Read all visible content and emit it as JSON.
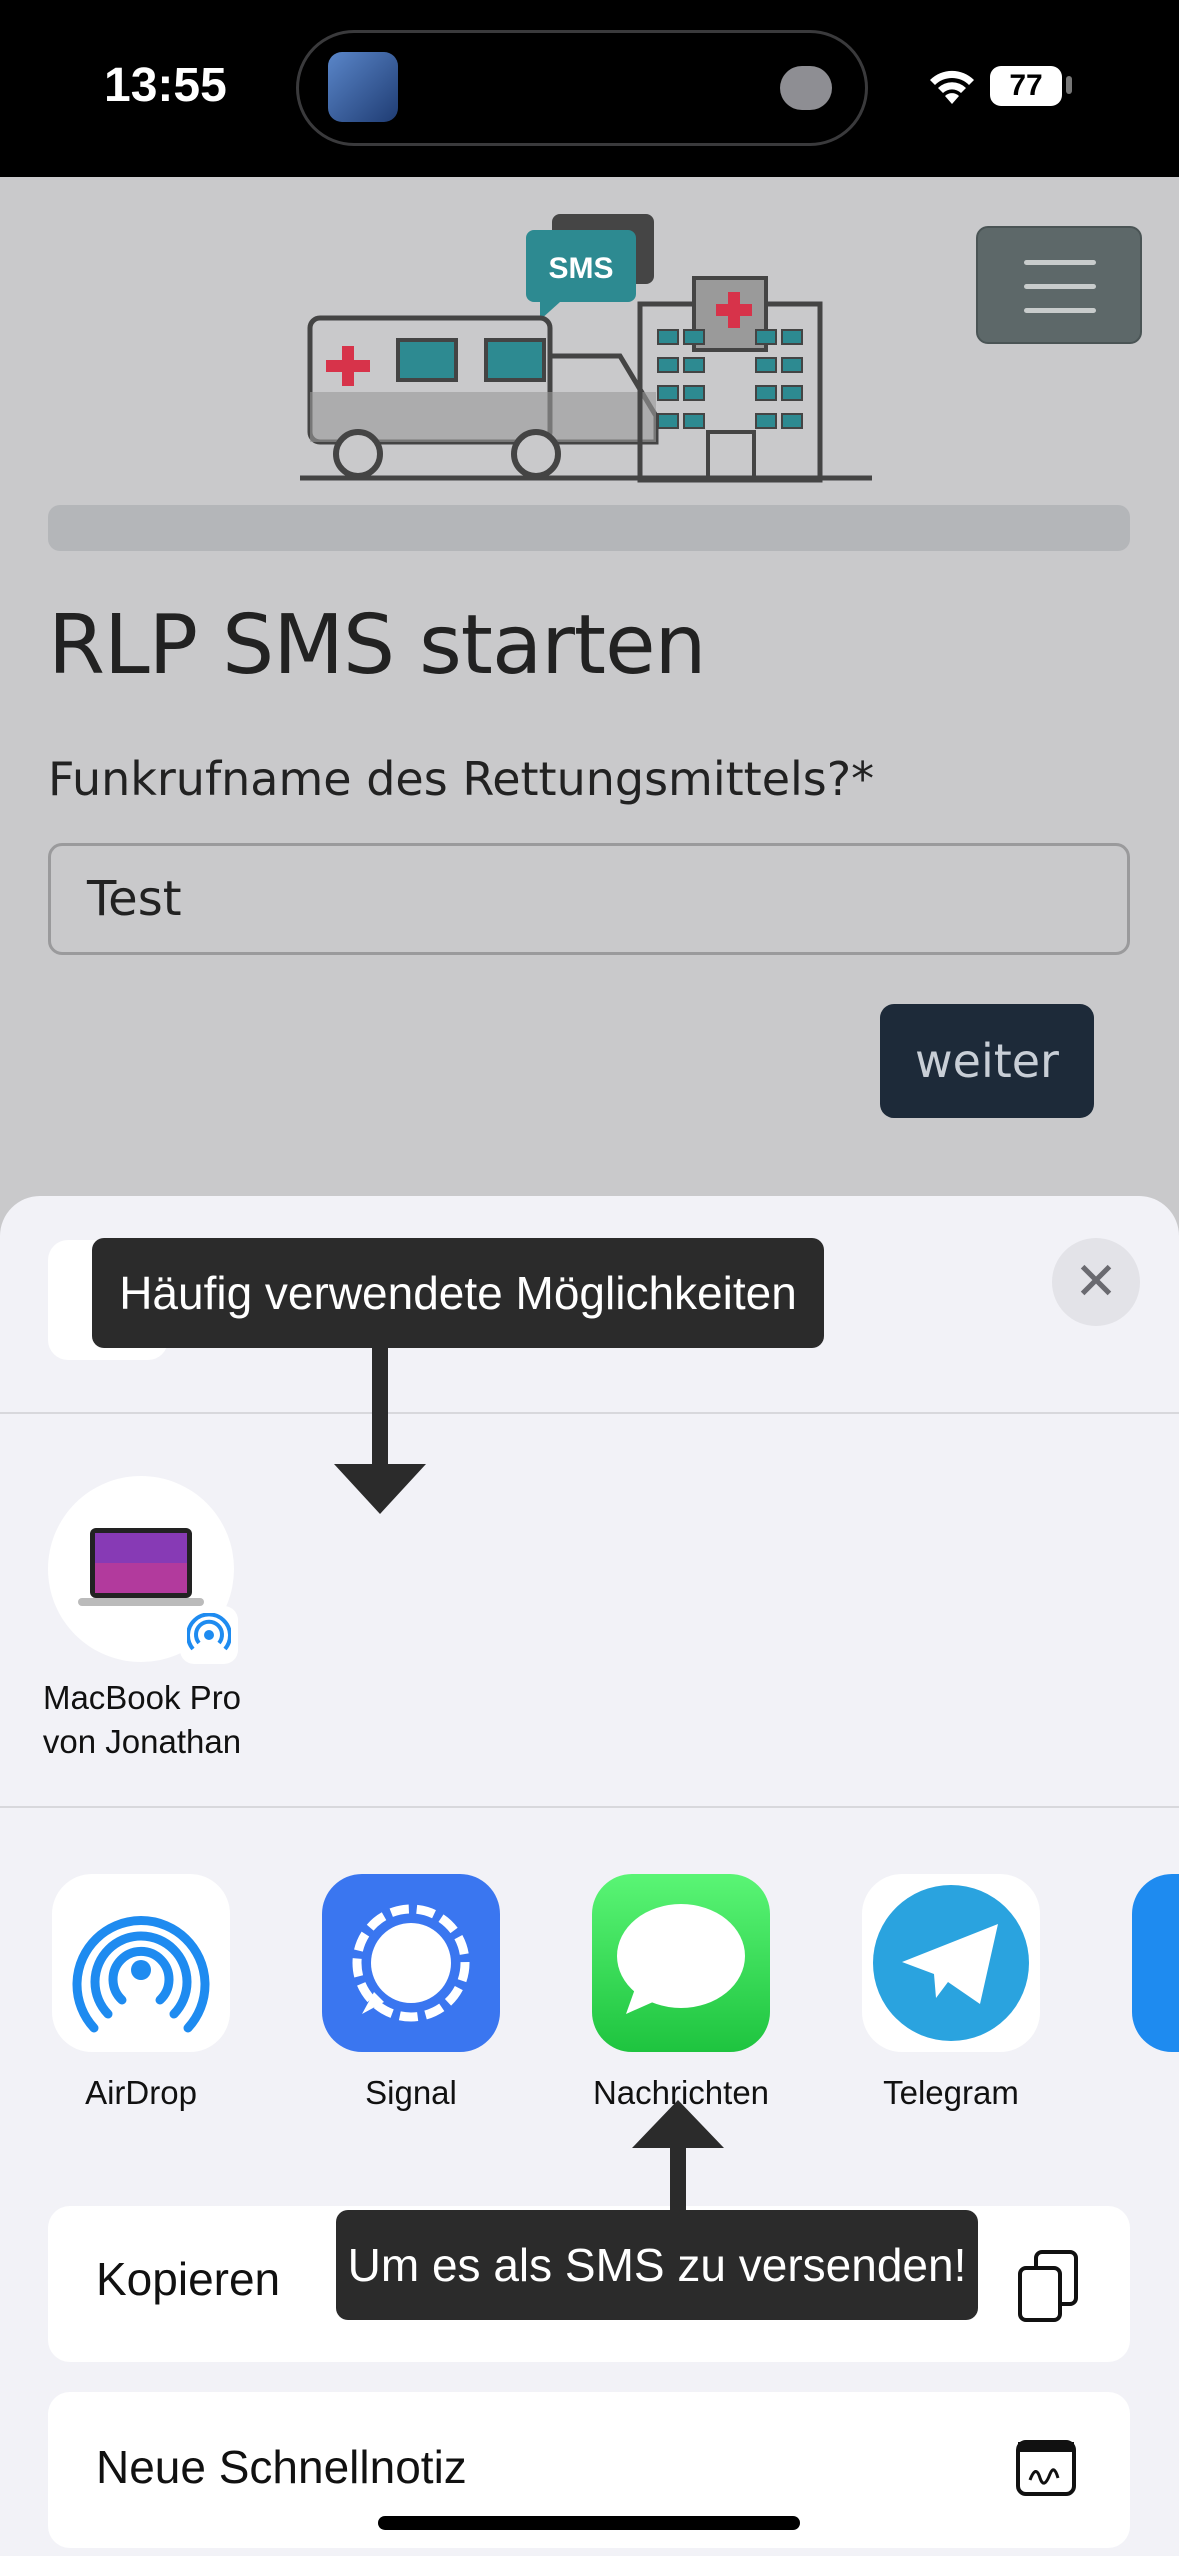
{
  "status_bar": {
    "time": "13:55",
    "battery": "77"
  },
  "page": {
    "title": "RLP SMS starten",
    "field_label": "Funkrufname des Rettungsmittels?*",
    "field_value": "Test",
    "next_button": "weiter",
    "illustration_badge": "SMS"
  },
  "share_sheet": {
    "airdrop_device": "MacBook Pro von Jonathan",
    "apps": [
      "AirDrop",
      "Signal",
      "Nachrichten",
      "Telegram"
    ],
    "actions": [
      "Kopieren",
      "Neue Schnellnotiz"
    ]
  },
  "annotations": {
    "top_tip": "Häufig verwendete Möglichkeiten",
    "bottom_tip": "Um es als SMS zu versenden!"
  },
  "colors": {
    "signal": "#3a76f0",
    "messages": "#34c759",
    "telegram": "#2aa3df",
    "airdrop": "#1e8bf0",
    "button_dark": "#1d2a39"
  }
}
